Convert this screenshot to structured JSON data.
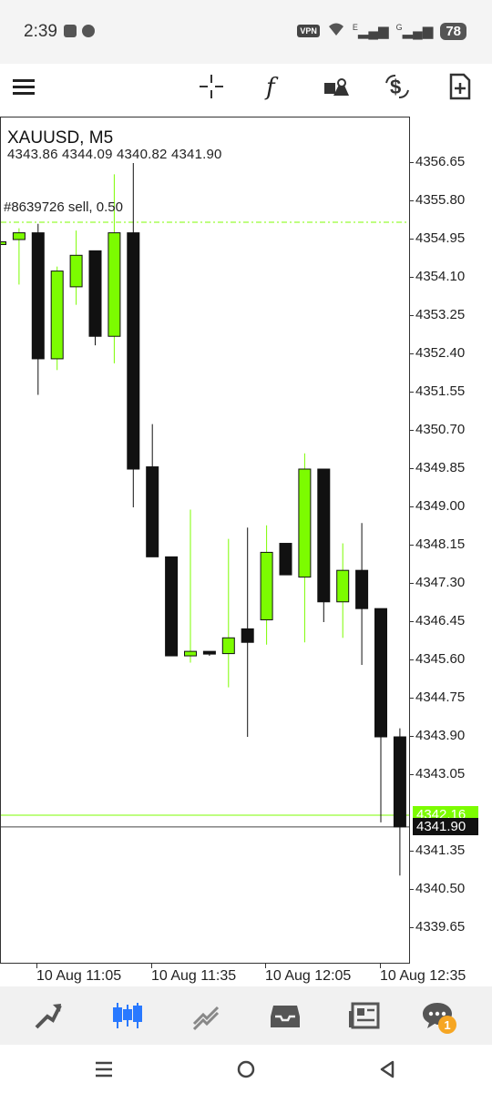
{
  "status": {
    "time": "2:39",
    "vpn": "VPN",
    "net1": "E",
    "net2": "G",
    "battery": "78"
  },
  "chart": {
    "symbol": "XAUUSD, M5",
    "ohlc": "4343.86 4344.09 4340.82 4341.90",
    "order_label": "#8639726 sell, 0.50",
    "bid_price": "4341.90",
    "ask_price": "4342.16",
    "price_axis": [
      "4356.65",
      "4355.80",
      "4354.95",
      "4354.10",
      "4353.25",
      "4352.40",
      "4351.55",
      "4350.70",
      "4349.85",
      "4349.00",
      "4348.15",
      "4347.30",
      "4346.45",
      "4345.60",
      "4344.75",
      "4343.90",
      "4343.05",
      "4341.35",
      "4340.50",
      "4339.65"
    ],
    "time_axis": [
      "10 Aug 11:05",
      "10 Aug 11:35",
      "10 Aug 12:05",
      "10 Aug 12:35"
    ],
    "bull_color": "#7CFC00",
    "bear_color": "#111111",
    "ask_line_color": "#7CFC00"
  },
  "chart_data": {
    "type": "candlestick",
    "symbol": "XAUUSD",
    "timeframe": "M5",
    "order_line": 4354.95,
    "bid": 4341.9,
    "ask": 4342.16,
    "ylim": [
      4339.2,
      4357.4
    ],
    "candles": [
      {
        "o": 4354.85,
        "h": 4355.0,
        "l": 4354.8,
        "c": 4354.9
      },
      {
        "o": 4354.95,
        "h": 4355.2,
        "l": 4353.95,
        "c": 4355.1
      },
      {
        "o": 4355.1,
        "h": 4355.3,
        "l": 4351.5,
        "c": 4352.3
      },
      {
        "o": 4352.3,
        "h": 4354.35,
        "l": 4352.05,
        "c": 4354.25
      },
      {
        "o": 4353.9,
        "h": 4355.15,
        "l": 4353.5,
        "c": 4354.6
      },
      {
        "o": 4354.7,
        "h": 4354.7,
        "l": 4352.6,
        "c": 4352.8
      },
      {
        "o": 4352.8,
        "h": 4356.4,
        "l": 4352.2,
        "c": 4355.1
      },
      {
        "o": 4355.1,
        "h": 4356.65,
        "l": 4349.0,
        "c": 4349.85
      },
      {
        "o": 4349.9,
        "h": 4350.85,
        "l": 4348.0,
        "c": 4347.9
      },
      {
        "o": 4347.9,
        "h": 4347.9,
        "l": 4345.75,
        "c": 4345.7
      },
      {
        "o": 4345.7,
        "h": 4348.95,
        "l": 4345.55,
        "c": 4345.8
      },
      {
        "o": 4345.8,
        "h": 4345.8,
        "l": 4345.7,
        "c": 4345.75
      },
      {
        "o": 4345.75,
        "h": 4348.3,
        "l": 4345.0,
        "c": 4346.1
      },
      {
        "o": 4346.3,
        "h": 4348.55,
        "l": 4343.9,
        "c": 4346.0
      },
      {
        "o": 4346.5,
        "h": 4348.6,
        "l": 4345.95,
        "c": 4348.0
      },
      {
        "o": 4348.2,
        "h": 4348.2,
        "l": 4347.5,
        "c": 4347.5
      },
      {
        "o": 4347.45,
        "h": 4350.2,
        "l": 4346.0,
        "c": 4349.85
      },
      {
        "o": 4349.85,
        "h": 4349.85,
        "l": 4346.45,
        "c": 4346.9
      },
      {
        "o": 4346.9,
        "h": 4348.2,
        "l": 4346.1,
        "c": 4347.6
      },
      {
        "o": 4347.6,
        "h": 4348.65,
        "l": 4345.5,
        "c": 4346.75
      },
      {
        "o": 4346.75,
        "h": 4346.75,
        "l": 4342.0,
        "c": 4343.9
      },
      {
        "o": 4343.9,
        "h": 4344.09,
        "l": 4340.82,
        "c": 4341.9
      }
    ]
  },
  "nav": {
    "badge_count": "1"
  }
}
